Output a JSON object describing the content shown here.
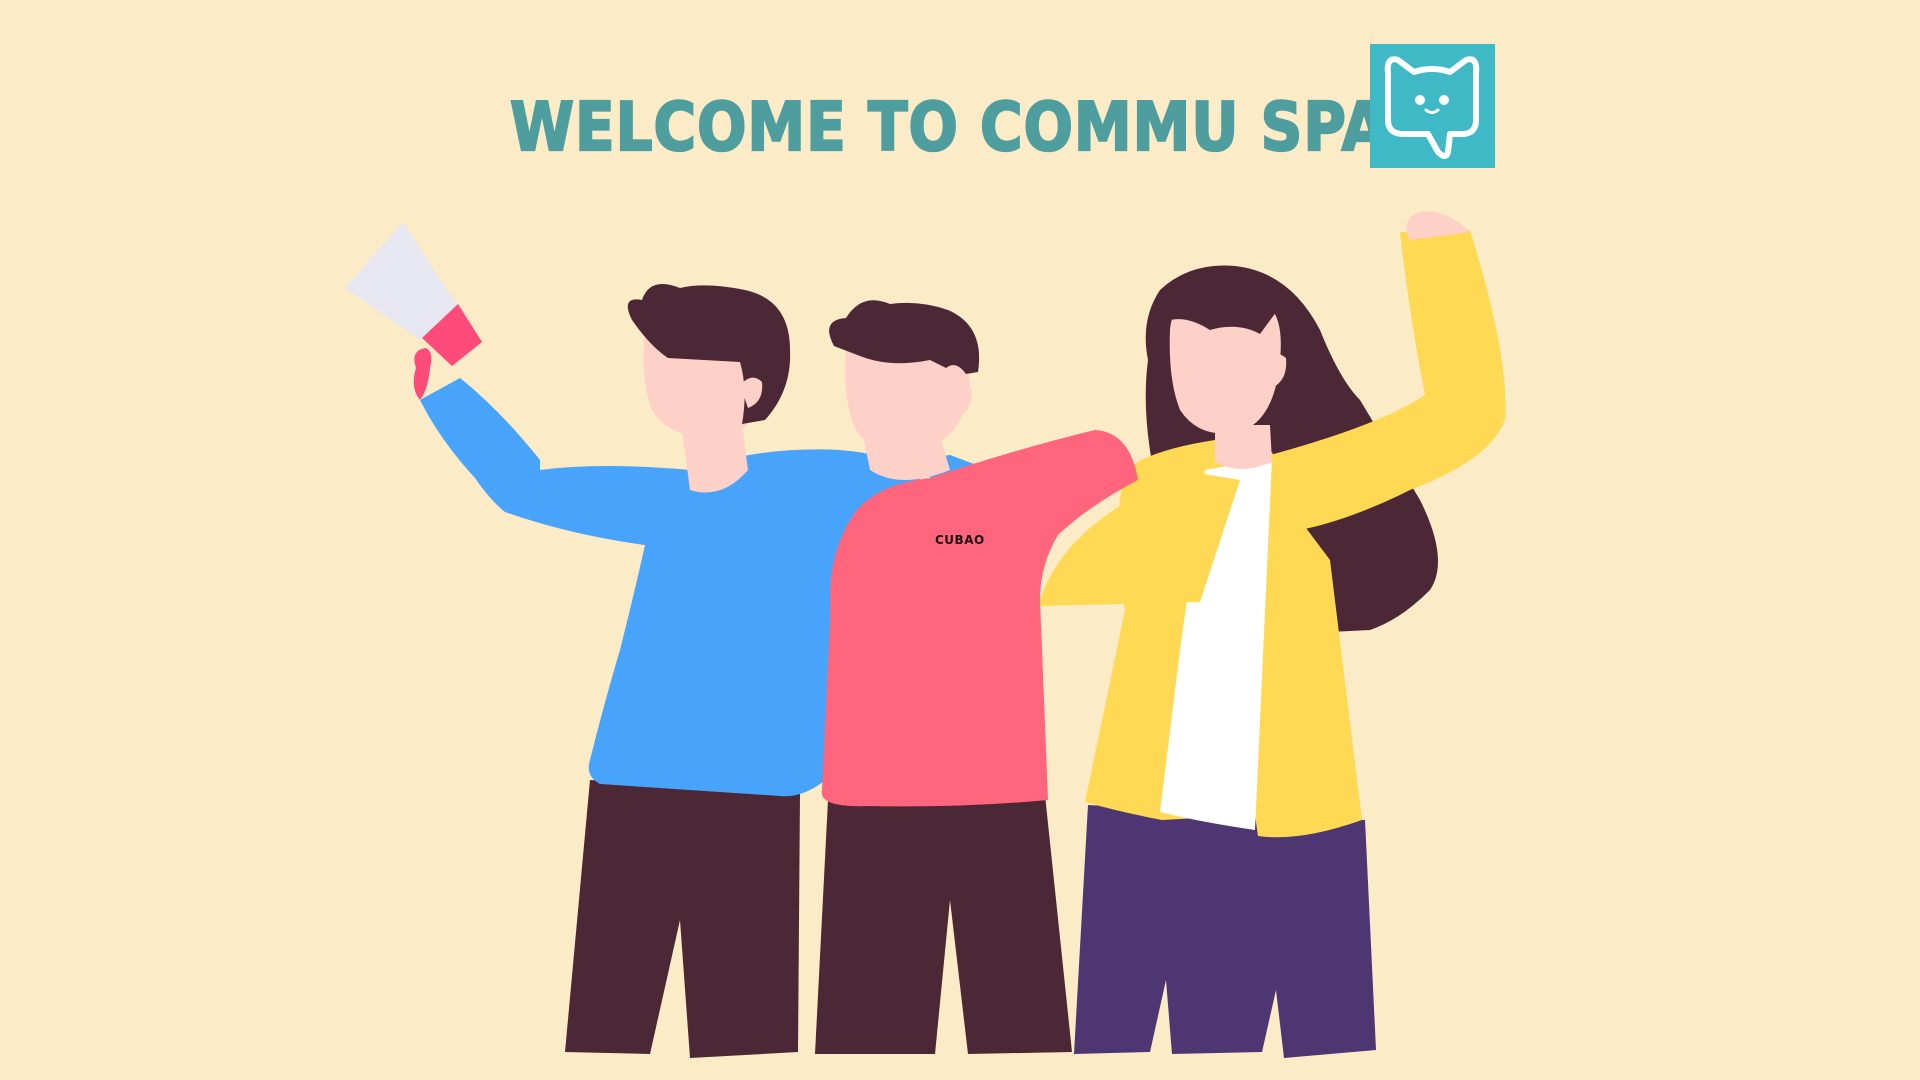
{
  "header": {
    "title": "WELCOME TO COMMU SPACE",
    "logo_icon": "chat-cat-icon"
  },
  "illustration": {
    "shirt_text": "CUBAO",
    "icons": [
      "megaphone-icon"
    ]
  },
  "colors": {
    "background": "#FBEBC6",
    "title": "#4E9E9F",
    "logo_bg": "#40B9C6",
    "blue_shirt": "#48A3FA",
    "pink_shirt": "#FF667E",
    "yellow_jacket": "#FFD954",
    "hair": "#4C2735",
    "skin": "#FDD0C8",
    "purple_pants": "#4E3673"
  }
}
